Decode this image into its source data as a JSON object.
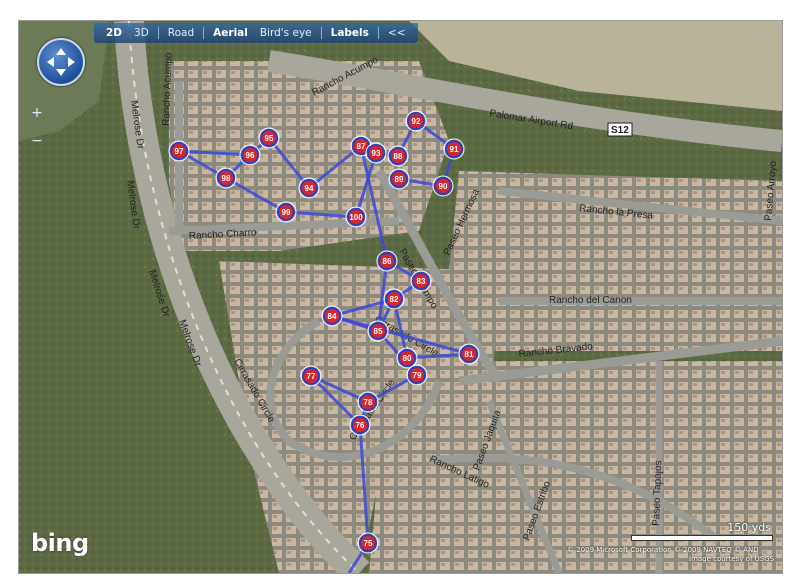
{
  "toolbar": {
    "items": [
      {
        "label": "2D",
        "active": true
      },
      {
        "label": "3D",
        "active": false
      },
      {
        "label": "Road",
        "active": false
      },
      {
        "label": "Aerial",
        "active": true
      },
      {
        "label": "Bird's eye",
        "active": false
      },
      {
        "label": "Labels",
        "active": true
      },
      {
        "label": "<<",
        "active": false
      }
    ]
  },
  "controls": {
    "zoom_in": "+",
    "zoom_out": "−",
    "compass_icon": "four-arrow-pan-icon"
  },
  "brand": "bing",
  "scale": {
    "label": "150 yds"
  },
  "copyright": {
    "line1": "© 2009 Microsoft Corporation   © 2009 NAVTEQ   © AND",
    "line2": "Image courtesy of USGS"
  },
  "road_labels": [
    "Palomar Airport Rd",
    "S12",
    "Rancho Acumpo",
    "Rancho Acumpo",
    "Melrose Dr",
    "Melrose Dr",
    "Melrose Dr",
    "Melrose Dr",
    "Rancho Charro",
    "Paseo Hermosa",
    "Paseo Acampo",
    "Rancho la Presa",
    "Rancho del Canon",
    "Rancho Bravado",
    "Cirrasado Circle",
    "Cirrasado Circle",
    "Rancho Latigo",
    "Paseo Jaquita",
    "Paseo Estribo",
    "Paseo Tapajos",
    "Paseo Arroyo",
    "Cirrasado Circle"
  ],
  "waypoints": [
    "97",
    "96",
    "95",
    "98",
    "94",
    "99",
    "87",
    "93",
    "88",
    "92",
    "91",
    "89",
    "90",
    "100",
    "86",
    "83",
    "82",
    "84",
    "85",
    "81",
    "80",
    "79",
    "77",
    "78",
    "76",
    "75"
  ],
  "colors": {
    "route": "#3b49d8",
    "marker_fill": "#d8262a",
    "marker_ring": "#2b3ec8"
  }
}
